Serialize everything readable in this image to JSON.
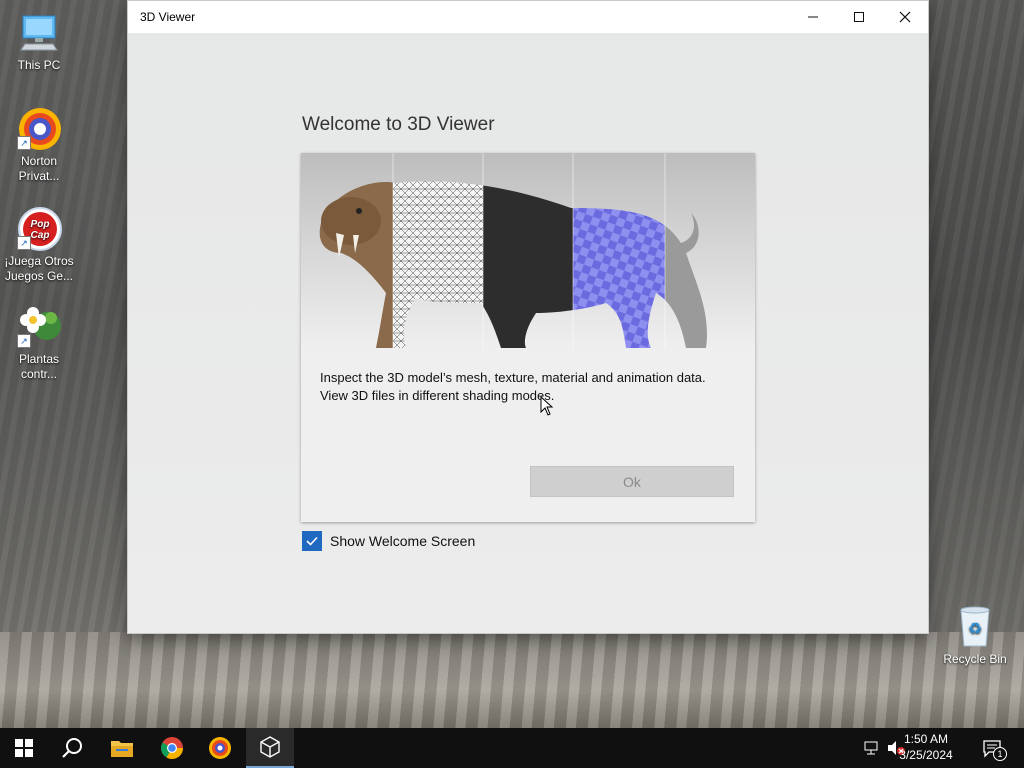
{
  "desktop": {
    "icons": [
      {
        "label": "This PC"
      },
      {
        "label": "Norton\nPrivat..."
      },
      {
        "label": "¡Juega Otros\nJuegos Ge..."
      },
      {
        "label": "Plantas\ncontr..."
      },
      {
        "label": "Recycle Bin"
      }
    ]
  },
  "window": {
    "title": "3D Viewer",
    "controls": {
      "minimize": "minimize",
      "maximize": "maximize",
      "close": "close"
    }
  },
  "welcome": {
    "heading": "Welcome to 3D Viewer",
    "description_line1": "Inspect the 3D model’s mesh, texture, material and animation data.",
    "description_line2": "View 3D files in different shading modes.",
    "ok_label": "Ok",
    "checkbox_label": "Show Welcome Screen",
    "checkbox_checked": true
  },
  "taskbar": {
    "time": "1:50 AM",
    "date": "3/25/2024",
    "notification_count": "1",
    "apps": [
      "start",
      "search",
      "file-explorer",
      "chrome",
      "norton",
      "3d-viewer"
    ]
  },
  "colors": {
    "accent": "#1f69c1",
    "taskbar": "#101010",
    "window_bg": "#e9eaea"
  }
}
